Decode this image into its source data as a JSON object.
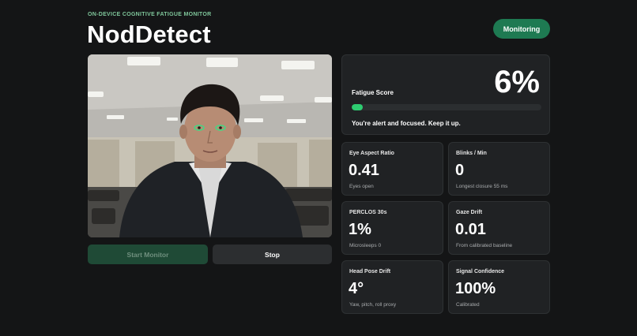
{
  "header": {
    "eyebrow": "ON-DEVICE COGNITIVE FATIGUE MONITOR",
    "title": "NodDetect",
    "status_label": "Monitoring"
  },
  "controls": {
    "start_label": "Start Monitor",
    "stop_label": "Stop"
  },
  "fatigue": {
    "label": "Fatigue Score",
    "value": "6%",
    "fraction": 0.06,
    "message": "You're alert and focused. Keep it up."
  },
  "metrics": [
    {
      "label": "Eye Aspect Ratio",
      "value": "0.41",
      "sub": "Eyes open"
    },
    {
      "label": "Blinks / Min",
      "value": "0",
      "sub": "Longest closure 55 ms"
    },
    {
      "label": "PERCLOS 30s",
      "value": "1%",
      "sub": "Microsleeps 0"
    },
    {
      "label": "Gaze Drift",
      "value": "0.01",
      "sub": "From calibrated baseline"
    },
    {
      "label": "Head Pose Drift",
      "value": "4°",
      "sub": "Yaw, pitch, roll proxy"
    },
    {
      "label": "Signal Confidence",
      "value": "100%",
      "sub": "Calibrated"
    }
  ],
  "colors": {
    "accent": "#1e7a52",
    "progress": "#2ecc71",
    "eye_landmarks": "#3ddc84"
  }
}
